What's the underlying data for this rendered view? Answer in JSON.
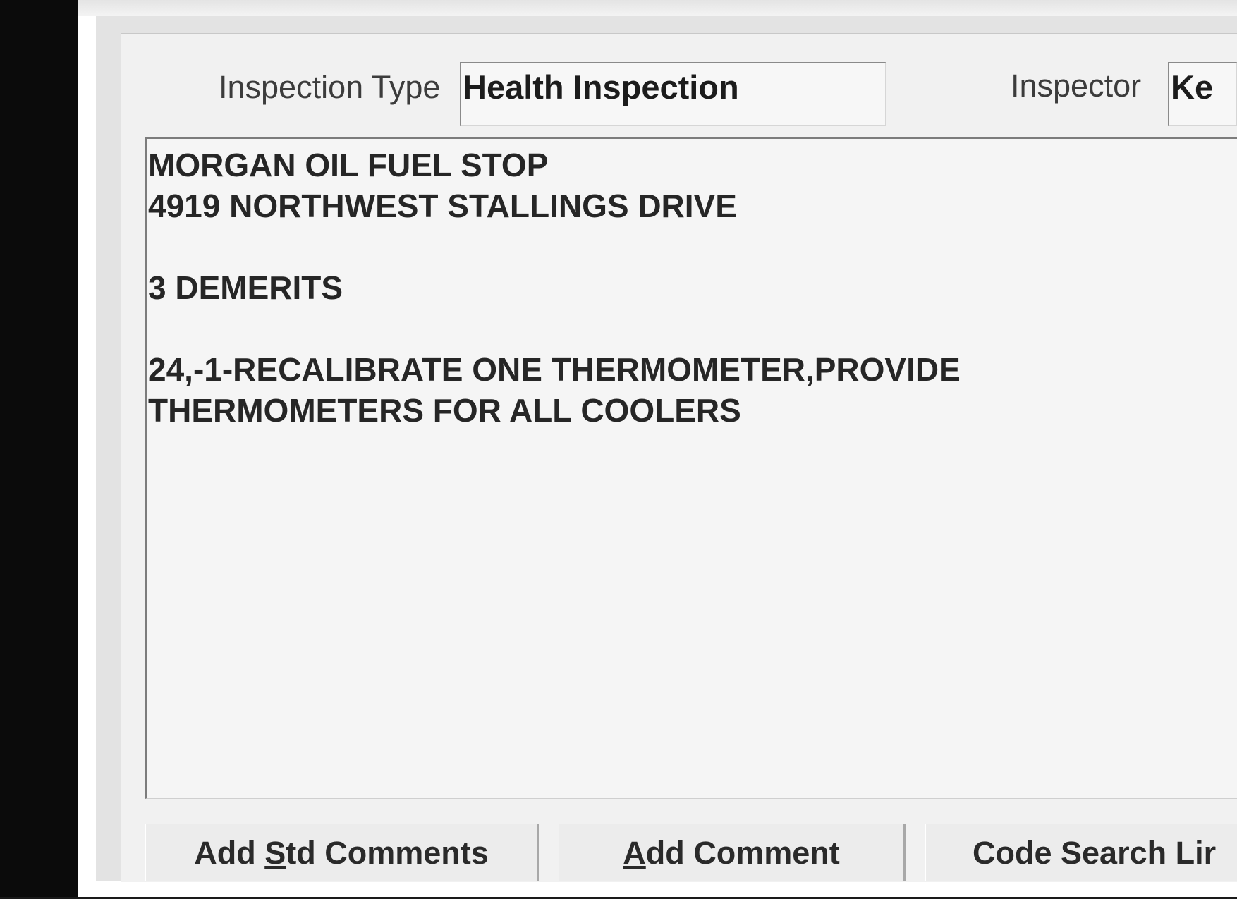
{
  "form": {
    "inspection_type_label": "Inspection Type",
    "inspection_type_value": "Health Inspection",
    "inspector_label": "Inspector",
    "inspector_value": "Ke"
  },
  "comments": {
    "lines": [
      "MORGAN OIL FUEL STOP",
      "4919 NORTHWEST STALLINGS DRIVE",
      "",
      "3 DEMERITS",
      "",
      "24,-1-RECALIBRATE ONE THERMOMETER,PROVIDE",
      "THERMOMETERS FOR ALL COOLERS"
    ]
  },
  "buttons": {
    "add_std_comments": {
      "before": "Add ",
      "mnemonic": "S",
      "after": "td Comments"
    },
    "add_comment": {
      "before": "",
      "mnemonic": "A",
      "after": "dd Comment"
    },
    "code_search": {
      "label": "Code Search Lir"
    }
  }
}
